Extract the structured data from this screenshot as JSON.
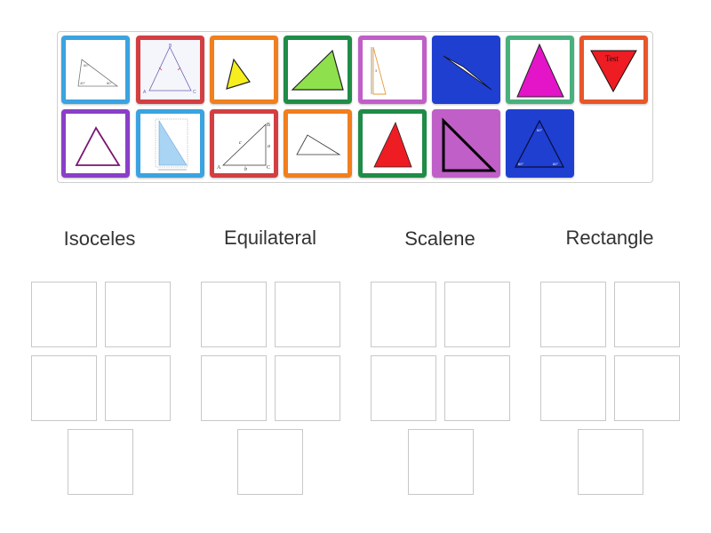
{
  "cards": [
    {
      "name": "card-triangle-angles",
      "color": "#3aa3e0",
      "icon": "triangle-with-angles-icon"
    },
    {
      "name": "card-triangle-isosceles-ab",
      "color": "#d23f42",
      "icon": "isosceles-triangle-labeled-icon"
    },
    {
      "name": "card-triangle-yellow",
      "color": "#f07f1d",
      "icon": "yellow-triangle-icon"
    },
    {
      "name": "card-triangle-green",
      "color": "#1f8c47",
      "icon": "green-triangle-icon"
    },
    {
      "name": "card-triangle-thin-orange",
      "color": "#c05fc8",
      "icon": "thin-right-triangle-icon"
    },
    {
      "name": "card-triangle-white-blue",
      "color": "#1e3fd0",
      "icon": "white-triangle-on-blue-icon"
    },
    {
      "name": "card-triangle-magenta",
      "color": "#48b07c",
      "icon": "magenta-triangle-icon"
    },
    {
      "name": "card-triangle-red-test",
      "color": "#e8562a",
      "icon": "red-inverted-triangle-icon",
      "label": "Test"
    },
    {
      "name": "card-triangle-purple-outline",
      "color": "#8a3fc9",
      "icon": "purple-outline-triangle-icon"
    },
    {
      "name": "card-triangle-blue-right",
      "color": "#3aa3e0",
      "icon": "blue-right-triangle-icon"
    },
    {
      "name": "card-triangle-abc-right",
      "color": "#d23f42",
      "icon": "labeled-right-triangle-icon",
      "label": "A B C a b c"
    },
    {
      "name": "card-triangle-small-outline",
      "color": "#f07f1d",
      "icon": "small-outline-triangle-icon"
    },
    {
      "name": "card-triangle-red-filled",
      "color": "#1f8c47",
      "icon": "red-filled-triangle-icon"
    },
    {
      "name": "card-triangle-black-on-purple",
      "color": "#c05fc8",
      "icon": "black-right-triangle-icon"
    },
    {
      "name": "card-triangle-blue-equilateral",
      "color": "#1e3fd0",
      "icon": "blue-triangle-with-angles-icon"
    }
  ],
  "categories": [
    {
      "label": "Isoceles"
    },
    {
      "label": "Equilateral"
    },
    {
      "label": "Scalene"
    },
    {
      "label": "Rectangle"
    }
  ],
  "card_test_label": "Test"
}
